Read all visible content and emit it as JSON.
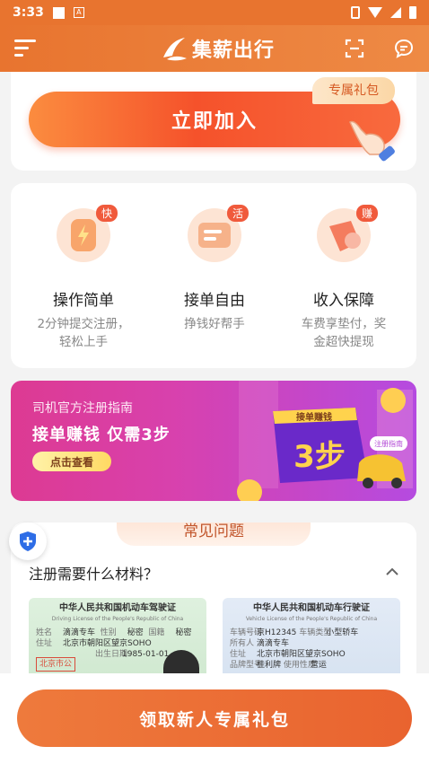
{
  "status_bar": {
    "time": "3:33",
    "notif_letter": "A"
  },
  "header": {
    "app_name": "集薪出行"
  },
  "promo": {
    "badge": "专属礼包",
    "join_label": "立即加入"
  },
  "features": [
    {
      "tag": "快",
      "title": "操作简单",
      "desc_line1": "2分钟提交注册，",
      "desc_line2": "轻松上手"
    },
    {
      "tag": "活",
      "title": "接单自由",
      "desc_line1": "挣钱好帮手",
      "desc_line2": ""
    },
    {
      "tag": "赚",
      "title": "收入保障",
      "desc_line1": "车费享垫付，奖",
      "desc_line2": "金超快提现"
    }
  ],
  "guide_banner": {
    "small_title": "司机官方注册指南",
    "big_title": "接单赚钱 仅需3步",
    "button_label": "点击查看",
    "art_ribbon": "接单赚钱",
    "art_steps": "3步",
    "art_tag": "注册指南"
  },
  "faq": {
    "tab_title": "常见问题",
    "question": "注册需要什么材料？",
    "license_card": {
      "title": "中华人民共和国机动车驾驶证",
      "subtitle": "Driving License of the People's Republic of China",
      "name_label": "姓名",
      "name": "滴滴专车",
      "sex_label": "性别",
      "sex": "秘密",
      "nation_label": "国籍",
      "nation": "秘密",
      "address_label": "住址",
      "address": "北京市朝阳区望京SOHO",
      "stamp": "北京市公",
      "dob_label": "出生日期",
      "dob": "1985-01-01"
    },
    "vehicle_card": {
      "title": "中华人民共和国机动车行驶证",
      "subtitle": "Vehicle License of the People's Republic of China",
      "plate_label": "车辆号码",
      "plate": "京H12345",
      "type_label": "车辆类型",
      "type": "小型轿车",
      "owner_label": "所有人",
      "owner": "滴滴专车",
      "address_label": "住址",
      "address": "北京市朝阳区望京SOHO",
      "model_label": "品牌型号",
      "model": "桂利牌",
      "use_label": "使用性质",
      "use": "营运"
    }
  },
  "cta": {
    "label": "领取新人专属礼包"
  },
  "colors": {
    "brand": "#e8742f",
    "accent_red": "#f5522b",
    "banner_pink": "#dd3a92",
    "banner_purple": "#b54be0"
  }
}
